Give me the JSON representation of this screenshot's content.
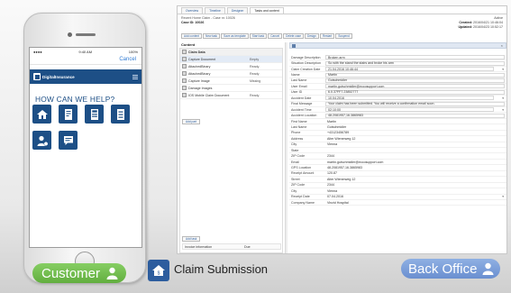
{
  "colors": {
    "brand_blue": "#1d4f86",
    "customer_green": "#6cb749",
    "backoffice_blue": "#7b9fd9",
    "link_blue": "#2f5f9c"
  },
  "phone": {
    "status_time": "9:40 AM",
    "status_battery": "100%",
    "cancel_label": "Cancel",
    "app_name": "DigitalInsurance",
    "help_heading": "HOW CAN WE HELP?",
    "tiles": [
      {
        "icon": "home-claim-icon"
      },
      {
        "icon": "document-form-icon"
      },
      {
        "icon": "calculator-icon"
      },
      {
        "icon": "checklist-icon"
      },
      {
        "icon": "user-dollar-icon"
      },
      {
        "icon": "chat-icon"
      }
    ]
  },
  "labels": {
    "customer": "Customer",
    "claim_submission": "Claim Submission",
    "back_office": "Back Office"
  },
  "window": {
    "tabs": [
      "Overview",
      "Timeline",
      "Designer",
      "Tasks and content"
    ],
    "active_tab": "Tasks and content",
    "case_line": "Recent Home Claim - Case nr. 10026",
    "case_id": "Case ID: 10026",
    "status_value": "Active",
    "created_label": "Created:",
    "created_value": "2016/04/21 10:46:04",
    "updated_label": "Updated:",
    "updated_value": "2016/04/23 10:52:17",
    "actions": [
      "Add content",
      "New task",
      "Save as template",
      "Start task",
      "Cancel",
      "Delete case",
      "Design",
      "Restart",
      "Suspend"
    ],
    "content_heading": "Content",
    "documents_header": "Claim Data",
    "documents": [
      {
        "name": "Capture Document",
        "status": "Empty"
      },
      {
        "name": "AttachedBinary",
        "status": "Ready"
      },
      {
        "name": "AttachedBinary",
        "status": "Ready"
      },
      {
        "name": "Capture Image",
        "status": "Missing"
      },
      {
        "name": "Damage Images",
        "status": ""
      },
      {
        "name": "IOS Mobile Claim Document",
        "status": "Ready"
      }
    ],
    "add_buttons": [
      "Add part",
      "Add task"
    ],
    "invoice_row": {
      "name": "Invoice information",
      "status": "Due"
    },
    "properties": [
      {
        "label": "Damage Description",
        "value": "Broken arm"
      },
      {
        "label": "Situation Description",
        "value": "So with the stand the stairs and broke his arm"
      },
      {
        "label": "Claim Creation Date",
        "value": "21.04.2016 10:46:44"
      },
      {
        "label": "Name",
        "value": "Martin"
      },
      {
        "label": "Last Name",
        "value": "Gutschmidler"
      },
      {
        "label": "User Email",
        "value": "martin.gutschmidler@eccosupport.com"
      },
      {
        "label": "User ID",
        "value": "6.0.37FF7.23852777"
      },
      {
        "label": "Accident Date",
        "value": "10.04.2016"
      },
      {
        "label": "Final Message",
        "value": "Your claim has been submitted. You will receive a confirmation email soon."
      },
      {
        "label": "Accident Time",
        "value": "02:10:00"
      },
      {
        "label": "Accident Location",
        "value": "48.2081957,16.3865983"
      },
      {
        "label": "First Name",
        "value": "Martin"
      },
      {
        "label": "Last Name",
        "value": "Gutschmidler"
      },
      {
        "label": "Phone",
        "value": "+43123456789"
      },
      {
        "label": "Address",
        "value": "Alter Wienerweg 12"
      },
      {
        "label": "City",
        "value": "Vienna"
      },
      {
        "label": "State",
        "value": ""
      },
      {
        "label": "ZIP Code",
        "value": "2344"
      },
      {
        "label": "Email",
        "value": "martin.gutschmidler@eccosupport.com"
      },
      {
        "label": "GPS Location",
        "value": "48.2081957,16.3865983"
      },
      {
        "label": "Receipt Amount",
        "value": "120.87"
      },
      {
        "label": "Street",
        "value": "Alter Wienerweg 12"
      },
      {
        "label": "ZIP Code",
        "value": "2344"
      },
      {
        "label": "City",
        "value": "Vienna"
      },
      {
        "label": "Receipt Date",
        "value": "07.04.2016"
      },
      {
        "label": "Company Name",
        "value": "Vinzid Hospital"
      }
    ]
  }
}
